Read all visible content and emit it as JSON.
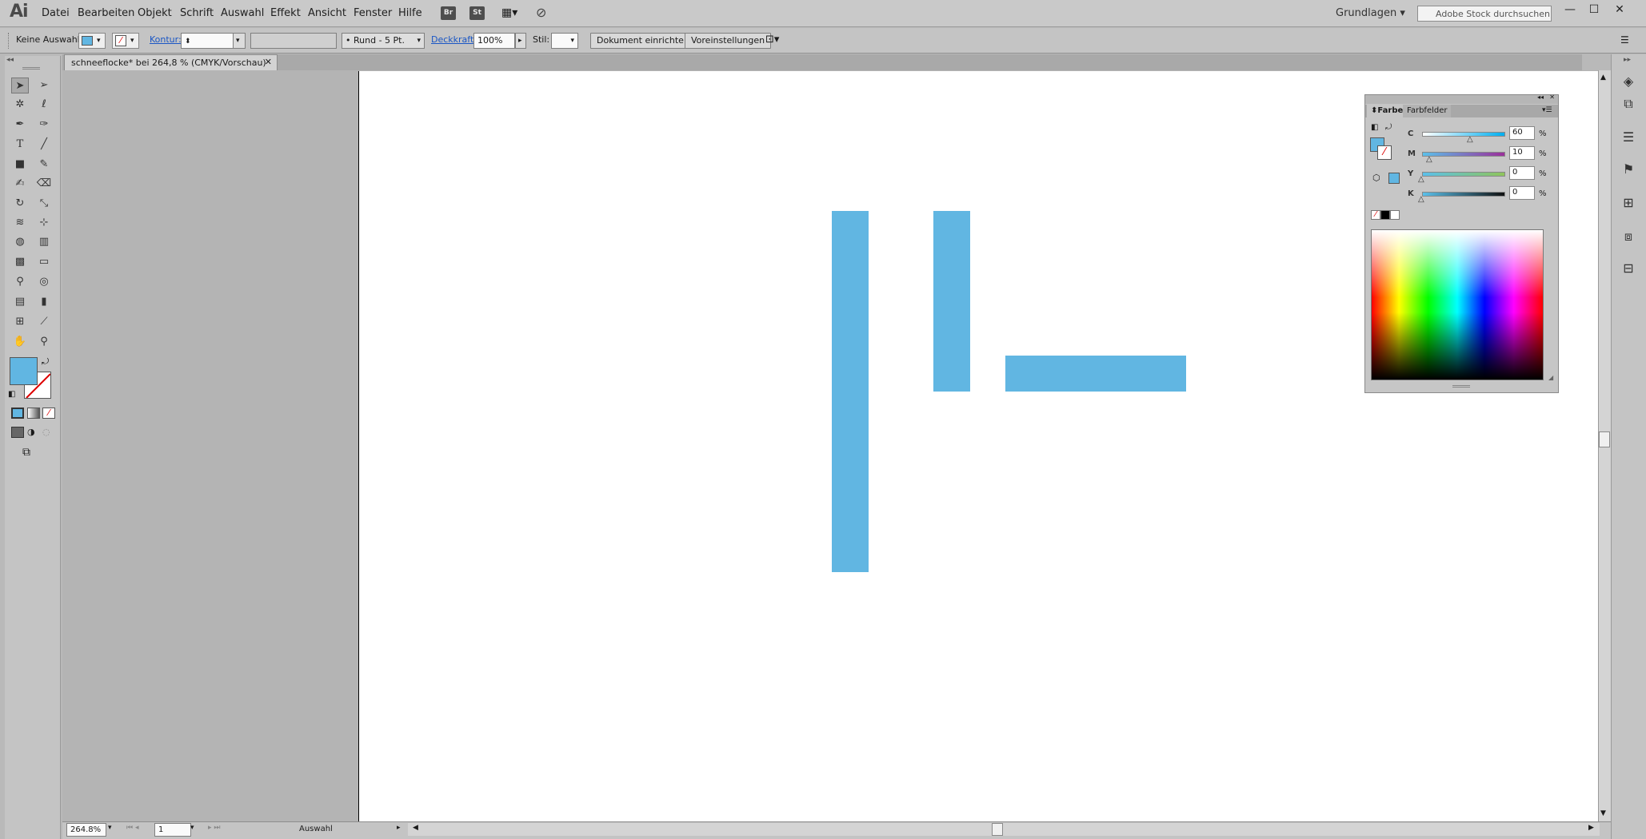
{
  "app": {
    "logo": "Ai"
  },
  "menu": [
    "Datei",
    "Bearbeiten",
    "Objekt",
    "Schrift",
    "Auswahl",
    "Effekt",
    "Ansicht",
    "Fenster",
    "Hilfe"
  ],
  "bridge_buttons": [
    "Br",
    "St"
  ],
  "workspace": "Grundlagen",
  "stock_search": {
    "placeholder": "Adobe Stock durchsuchen"
  },
  "control": {
    "selection": "Keine Auswahl",
    "stroke_label": "Kontur:",
    "stroke_profile": "Rund - 5 Pt.",
    "opacity_label": "Deckkraft:",
    "opacity": "100%",
    "style_label": "Stil:",
    "doc_setup": "Dokument einrichten",
    "prefs": "Voreinstellungen"
  },
  "document": {
    "tab_title": "schneeflocke* bei 264,8 % (CMYK/Vorschau)"
  },
  "status": {
    "zoom": "264.8%",
    "artboard": "1",
    "tool": "Auswahl"
  },
  "colors": {
    "fill": "#61b6e2"
  },
  "color_panel": {
    "tabs": [
      "Farbe",
      "Farbfelder"
    ],
    "channels": [
      {
        "label": "C",
        "value": "60"
      },
      {
        "label": "M",
        "value": "10"
      },
      {
        "label": "Y",
        "value": "0"
      },
      {
        "label": "K",
        "value": "0"
      }
    ],
    "unit": "%"
  }
}
